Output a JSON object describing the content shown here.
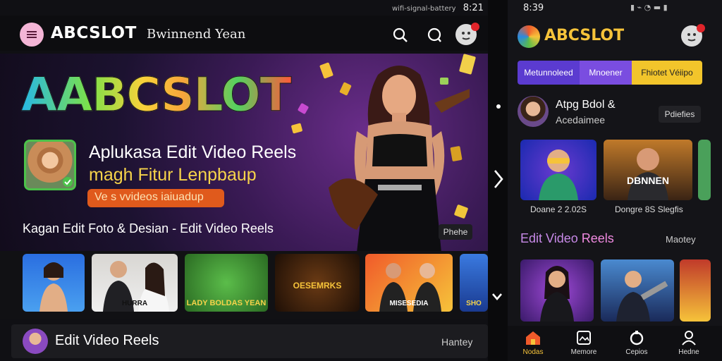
{
  "left_status": {
    "icons": "wifi-signal-battery",
    "time": "8:21"
  },
  "header": {
    "brand": "ABCSLOT",
    "subtitle": "Bwinnend Yean"
  },
  "hero": {
    "logo_text": "AABCSLOT",
    "headline_1": "Aplukasa Edit Video Reels",
    "headline_2": "magh Fitur Lenpbaup",
    "pill": "Ve s vvideos iaiuadup",
    "tagline": "Kagan Edit Foto & Desian - Edit Video Reels",
    "button": "Phehe"
  },
  "tiles": [
    {
      "caption": ""
    },
    {
      "caption": "HURRA"
    },
    {
      "caption": "LADY BOLDAS YEAN"
    },
    {
      "caption": "OESEMRKS"
    },
    {
      "caption": "MISESEDIA"
    },
    {
      "caption": "SHO"
    }
  ],
  "bottom_row": {
    "title": "Edit Video Reels",
    "action": "Hantey"
  },
  "right_status": {
    "time": "8:39"
  },
  "right_header": {
    "brand": "ABCSLOT"
  },
  "right_tabs": [
    {
      "label": "Metunnoleed",
      "color": "#5b3bd0"
    },
    {
      "label": "Mnoener",
      "color": "#7a4de0"
    },
    {
      "label": "Fhiotet Véiipo",
      "color": "#f2c52b"
    }
  ],
  "profile": {
    "name": "Atpg Bdol &",
    "handle": "Acedaimee",
    "action": "Pdiefies"
  },
  "right_cards": [
    {
      "caption": "Doane 2 2.02S"
    },
    {
      "caption": "Dongre 8S Slegfis",
      "overlay": "DBNNEN"
    }
  ],
  "section": {
    "title_a": "Edit Video",
    "title_b": "Reels",
    "action": "Maotey"
  },
  "nav": [
    {
      "label": "Nodas",
      "icon": "home-icon"
    },
    {
      "label": "Memore",
      "icon": "gallery-icon"
    },
    {
      "label": "Cepios",
      "icon": "loop-icon"
    },
    {
      "label": "Hedne",
      "icon": "person-icon"
    }
  ]
}
